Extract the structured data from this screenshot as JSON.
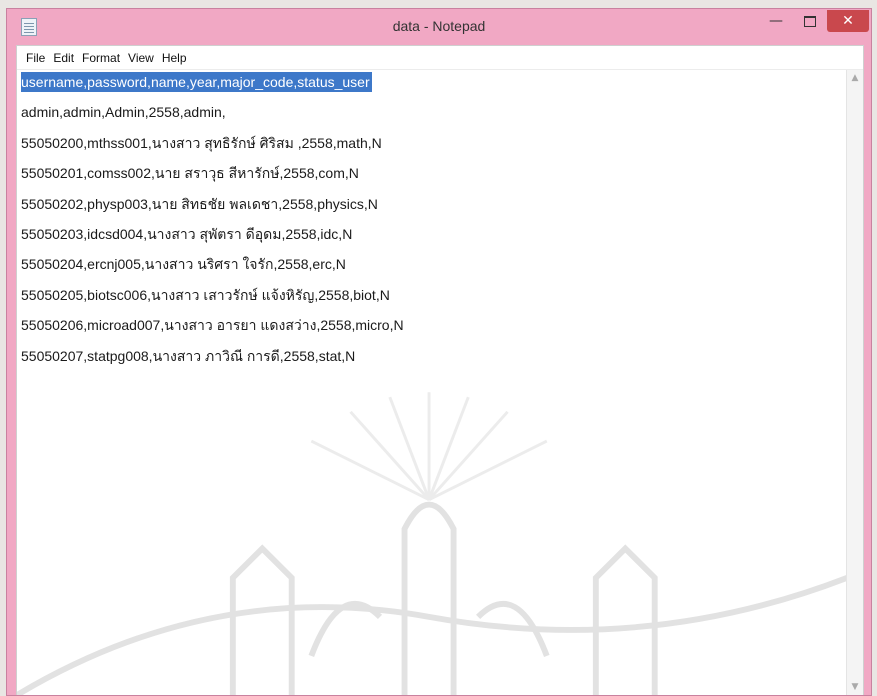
{
  "window": {
    "title": "data - Notepad",
    "minimize_glyph": "—",
    "close_glyph": "✕"
  },
  "menu": [
    "File",
    "Edit",
    "Format",
    "View",
    "Help"
  ],
  "editor": {
    "lines": [
      "username,password,name,year,major_code,status_user",
      "admin,admin,Admin,2558,admin,",
      "55050200,mthss001,นางสาว สุทธิรักษ์ ศิริสม ,2558,math,N",
      "55050201,comss002,นาย สราวุธ สีหารักษ์,2558,com,N",
      "55050202,physp003,นาย สิทธชัย พลเดชา,2558,physics,N",
      "55050203,idcsd004,นางสาว สุพัตรา ดีอุดม,2558,idc,N",
      "55050204,ercnj005,นางสาว นริศรา ใจรัก,2558,erc,N",
      "55050205,biotsc006,นางสาว เสาวรักษ์ แจ้งหิรัญ,2558,biot,N",
      "55050206,microad007,นางสาว อารยา แดงสว่าง,2558,micro,N",
      "55050207,statpg008,นางสาว ภาวิณี การดี,2558,stat,N"
    ],
    "selected_line": 0
  },
  "colors": {
    "titlebar": "#f1a8c4",
    "selection": "#3d78c9",
    "close_button": "#c9484d"
  }
}
